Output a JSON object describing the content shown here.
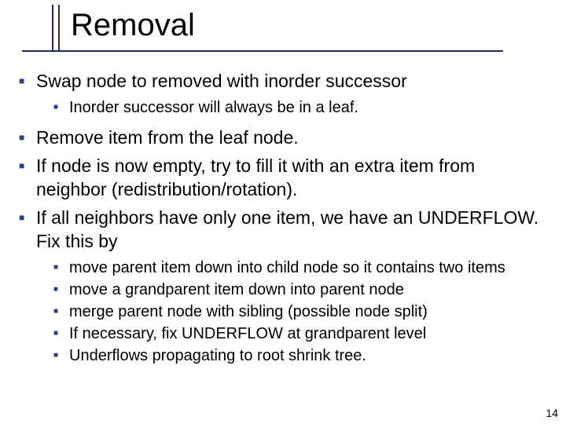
{
  "slide": {
    "title": "Removal",
    "page_number": "14"
  },
  "bullets": {
    "b1": "Swap node to removed with inorder successor",
    "b1_1": "Inorder successor will always be in a leaf.",
    "b2": "Remove item from the leaf node.",
    "b3": "If node is now empty, try to fill it with an extra item from neighbor (redistribution/rotation).",
    "b4": "If all neighbors have only one item, we have an UNDERFLOW. Fix this by",
    "b4_1": "move parent item down into child node so it contains two items",
    "b4_2": "move a grandparent item down into parent node",
    "b4_3": "merge parent node with sibling (possible node split)",
    "b4_4": "If necessary, fix UNDERFLOW at grandparent level",
    "b4_5": "Underflows propagating to root shrink tree."
  }
}
